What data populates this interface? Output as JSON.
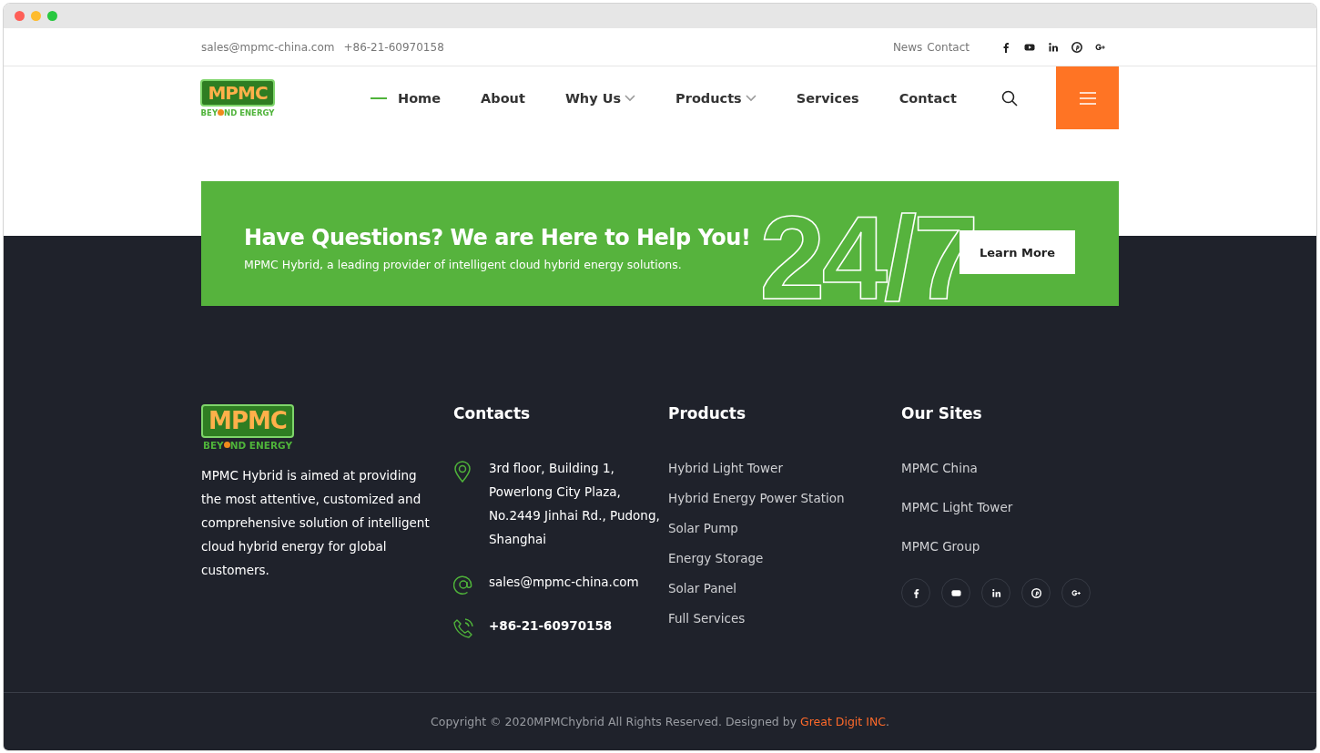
{
  "topbar": {
    "email": "sales@mpmc-china.com",
    "phone": "+86-21-60970158",
    "links": [
      "News",
      "Contact"
    ]
  },
  "header_logo": {
    "mark": "MPMC",
    "tagline_start": "BEY",
    "tagline_end": "ND ENERGY"
  },
  "nav": {
    "items": [
      {
        "label": "Home",
        "selected": true,
        "dropdown": false
      },
      {
        "label": "About",
        "selected": false,
        "dropdown": false
      },
      {
        "label": "Why Us",
        "selected": false,
        "dropdown": true
      },
      {
        "label": "Products",
        "selected": false,
        "dropdown": true
      },
      {
        "label": "Services",
        "selected": false,
        "dropdown": false
      },
      {
        "label": "Contact",
        "selected": false,
        "dropdown": false
      }
    ]
  },
  "banner": {
    "title": "Have Questions? We are Here to Help You!",
    "subtitle": "MPMC Hybrid, a leading provider of intelligent cloud hybrid energy solutions.",
    "big_text": "24/7",
    "button": "Learn More"
  },
  "footer": {
    "logo": {
      "mark": "MPMC",
      "tagline_start": "BEY",
      "tagline_end": "ND ENERGY"
    },
    "about": "MPMC Hybrid is aimed at providing the most attentive, customized and comprehensive solution of intelligent cloud hybrid energy for global customers.",
    "contacts": {
      "title": "Contacts",
      "items": [
        {
          "kind": "address",
          "text": "3rd floor, Building 1, Powerlong City Plaza, No.2449 Jinhai Rd., Pudong, Shanghai"
        },
        {
          "kind": "email",
          "text": "sales@mpmc-china.com"
        },
        {
          "kind": "phone",
          "text": "+86-21-60970158"
        }
      ]
    },
    "products": {
      "title": "Products",
      "items": [
        "Hybrid Light Tower",
        "Hybrid Energy Power Station",
        "Solar Pump",
        "Energy Storage",
        "Solar Panel",
        "Full Services"
      ]
    },
    "sites": {
      "title": "Our Sites",
      "items": [
        "MPMC China",
        "MPMC Light Tower",
        "MPMC Group"
      ]
    }
  },
  "copyright": {
    "text": "Copyright © 2020MPMChybrid All Rights Reserved. Designed by ",
    "link": "Great Digit INC",
    "end": "."
  }
}
